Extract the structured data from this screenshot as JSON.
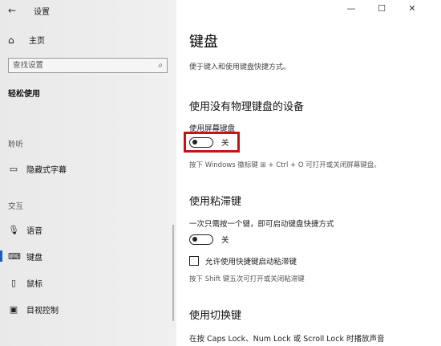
{
  "window": {
    "title": "设置",
    "minimize": "—",
    "maximize": "☐",
    "close": "✕"
  },
  "sidebar": {
    "back_icon": "←",
    "home_label": "主页",
    "search_placeholder": "查找设置",
    "category": "轻松使用",
    "groups": [
      {
        "label": "聆听",
        "items": [
          {
            "label": "隐藏式字幕",
            "icon": "captions-icon"
          }
        ]
      },
      {
        "label": "交互",
        "items": [
          {
            "label": "语音",
            "icon": "microphone-icon"
          },
          {
            "label": "键盘",
            "icon": "keyboard-icon",
            "active": true
          },
          {
            "label": "鼠标",
            "icon": "mouse-icon"
          },
          {
            "label": "目视控制",
            "icon": "eye-control-icon"
          }
        ]
      }
    ]
  },
  "main": {
    "title": "键盘",
    "description": "便于键入和使用键盘快捷方式。",
    "sections": [
      {
        "title": "使用没有物理键盘的设备",
        "setting_label": "使用屏幕键盘",
        "toggle_state": "关",
        "hint": "按下 Windows 徽标键 ⊞ + Ctrl + O 可打开或关闭屏幕键盘。"
      },
      {
        "title": "使用粘滞键",
        "setting_label": "一次只需按一个键，即可启动键盘快捷方式",
        "toggle_state": "关",
        "checkbox_label": "允许使用快捷键启动粘滞键",
        "hint": "按下 Shift 键五次可打开或关闭粘滞键"
      },
      {
        "title": "使用切换键",
        "setting_label": "在按 Caps Lock、Num Lock 或 Scroll Lock 时播放声音"
      }
    ]
  },
  "colors": {
    "highlight": "#c0180f",
    "accent": "#1a5fb4",
    "sidebar_bg": "#ececec"
  }
}
